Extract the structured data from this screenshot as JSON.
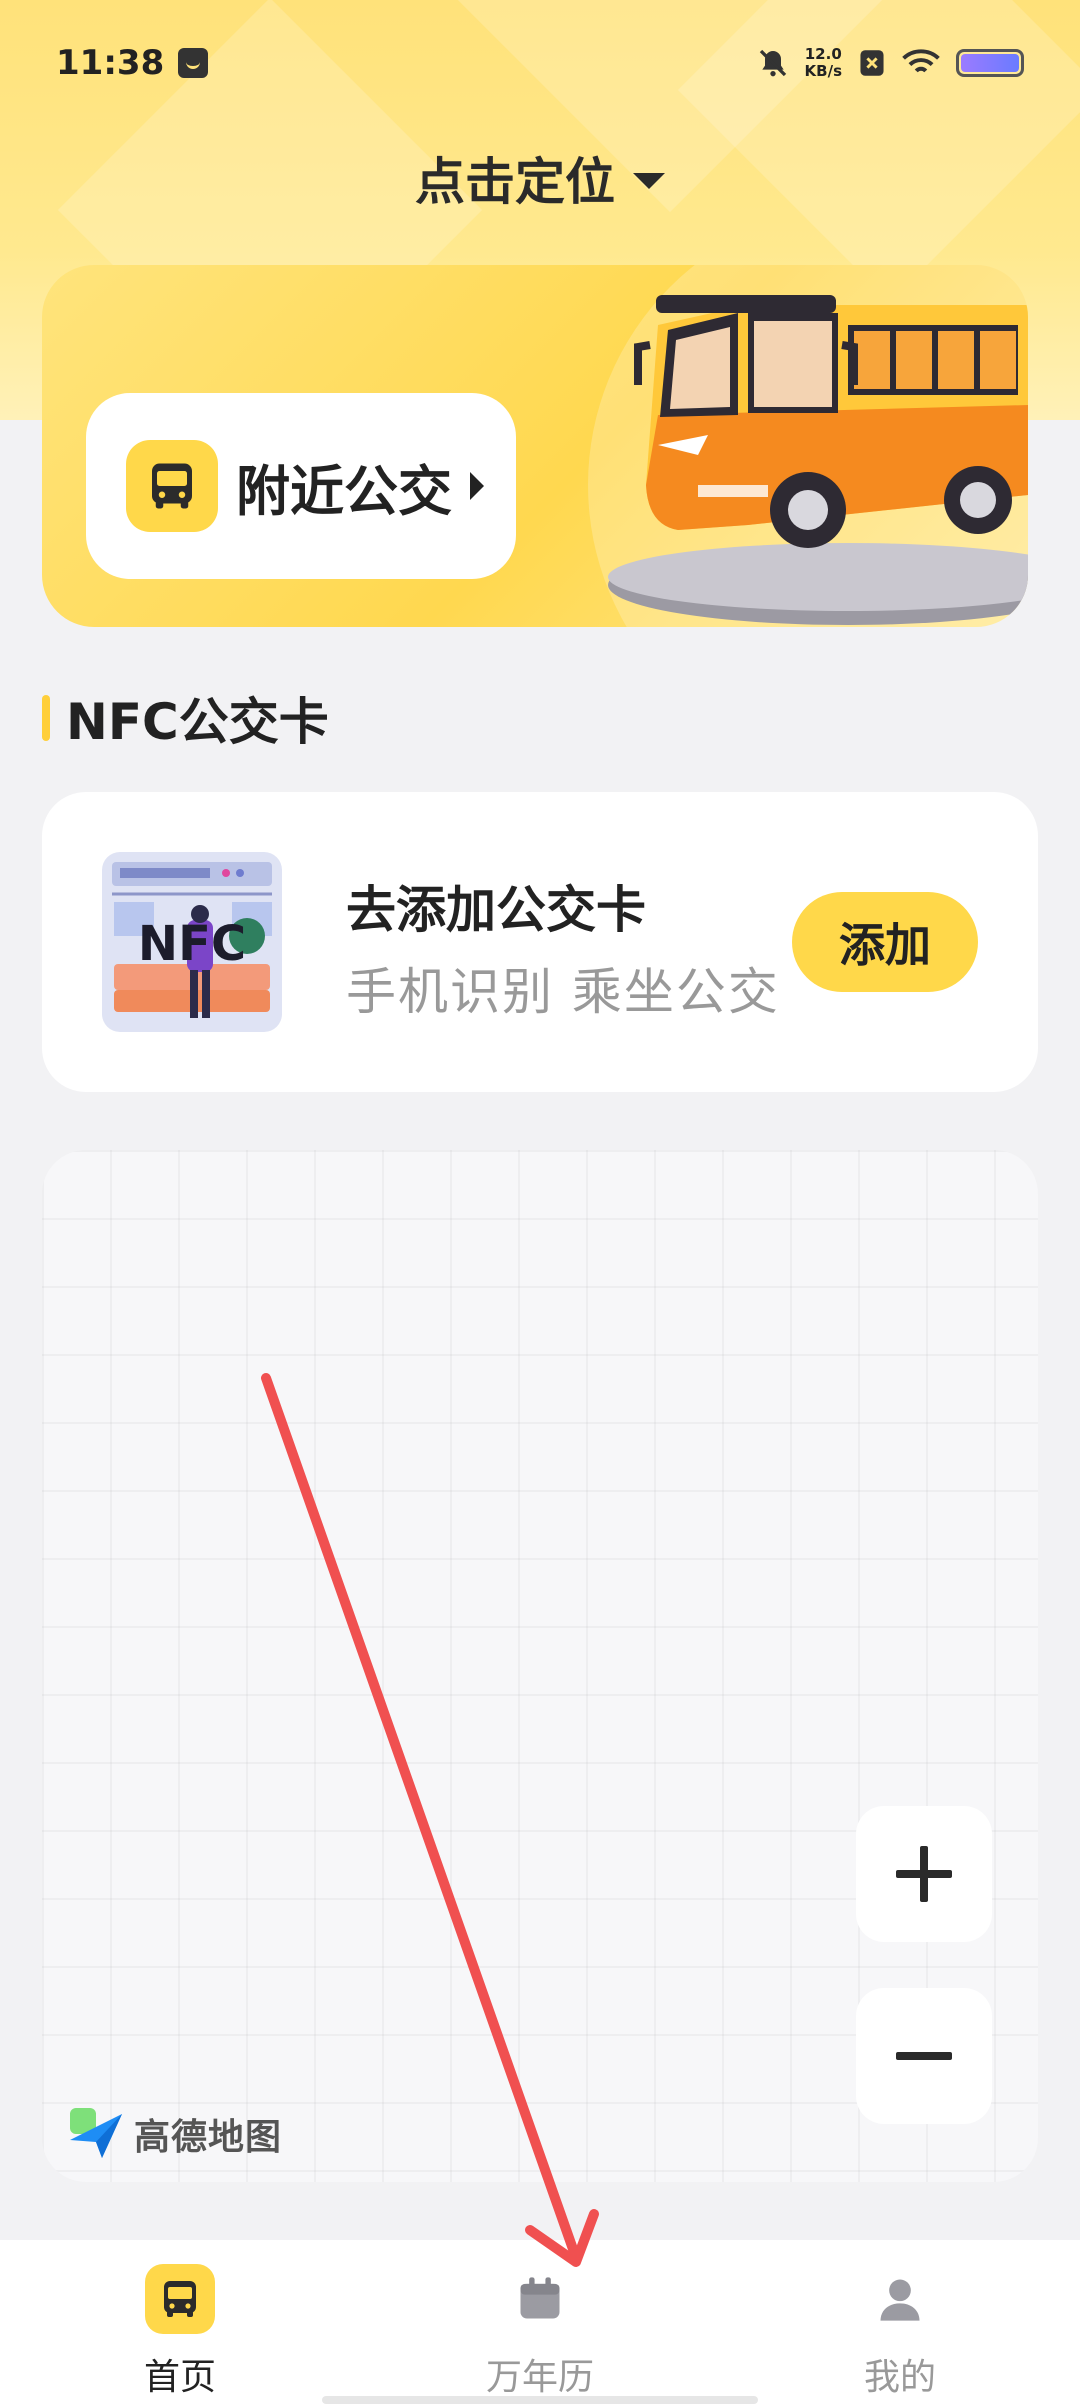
{
  "status_bar": {
    "time": "11:38",
    "net_speed_value": "12.0",
    "net_speed_unit": "KB/s"
  },
  "header": {
    "location_label": "点击定位"
  },
  "banner": {
    "nearby_label": "附近公交"
  },
  "nfc_section": {
    "title": "NFC公交卡",
    "card_title": "去添加公交卡",
    "card_subtitle": "手机识别 乘坐公交",
    "add_label": "添加",
    "thumb_text": "NFC"
  },
  "map": {
    "provider_label": "高德地图"
  },
  "tabs": [
    {
      "label": "首页",
      "icon": "bus-icon",
      "active": true
    },
    {
      "label": "万年历",
      "icon": "calendar-icon",
      "active": false
    },
    {
      "label": "我的",
      "icon": "person-icon",
      "active": false
    }
  ],
  "colors": {
    "accent": "#ffd84a",
    "annotation": "#f05050"
  }
}
